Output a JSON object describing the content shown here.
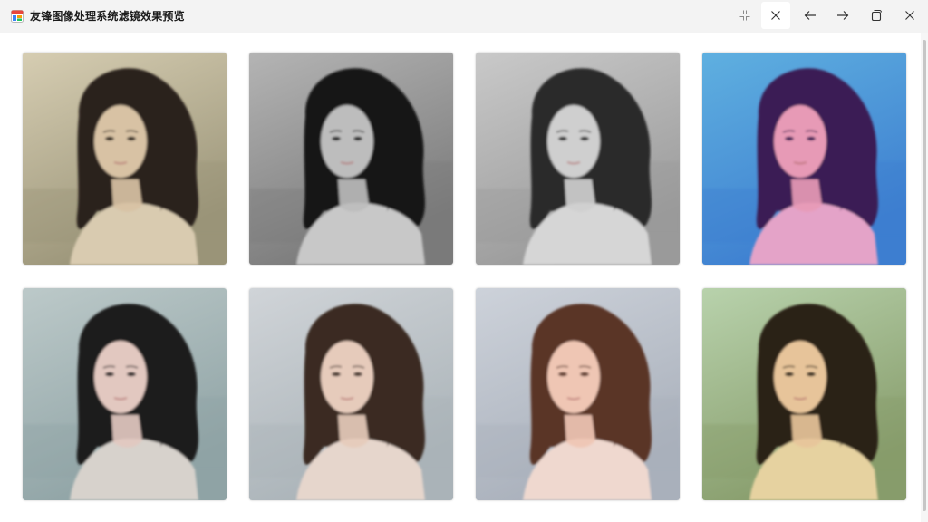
{
  "window": {
    "title": "友锋图像处理系统滤镜效果预览",
    "app_icon": "photo-app-icon",
    "buttons": [
      {
        "name": "compact-view-button",
        "icon": "compress-icon"
      },
      {
        "name": "close-preview-button",
        "icon": "close-icon"
      },
      {
        "name": "previous-button",
        "icon": "arrow-left-icon"
      },
      {
        "name": "next-button",
        "icon": "arrow-right-icon"
      },
      {
        "name": "restore-button",
        "icon": "restore-icon"
      },
      {
        "name": "close-window-button",
        "icon": "close-icon"
      }
    ]
  },
  "gallery": {
    "columns": 4,
    "rows": 2,
    "tiles": [
      {
        "name": "filter-preview-vintage",
        "bg1": "#d6cdb2",
        "bg2": "#9a9478",
        "hair": "#2a241c",
        "skin": "#d8c2a4",
        "sweater": "#d9cbb0"
      },
      {
        "name": "filter-preview-bw-high-contrast",
        "bg1": "#b4b4b4",
        "bg2": "#7a7a7a",
        "hair": "#161616",
        "skin": "#bdbdbd",
        "sweater": "#c8c8c8"
      },
      {
        "name": "filter-preview-grayscale",
        "bg1": "#c9c9c9",
        "bg2": "#9a9a9a",
        "hair": "#2b2b2b",
        "skin": "#cfcfcf",
        "sweater": "#d6d6d6"
      },
      {
        "name": "filter-preview-cool-blue",
        "bg1": "#5fb0e0",
        "bg2": "#3d7ed0",
        "hair": "#3a1f55",
        "skin": "#e79ab6",
        "sweater": "#e4a3c8"
      },
      {
        "name": "filter-preview-cool-tone",
        "bg1": "#bcc9c9",
        "bg2": "#8fa3a5",
        "hair": "#1c1c1e",
        "skin": "#e2c8c0",
        "sweater": "#d7d2cc"
      },
      {
        "name": "filter-preview-faded",
        "bg1": "#d0d4d8",
        "bg2": "#aab3b8",
        "hair": "#3a2a22",
        "skin": "#e6cbbb",
        "sweater": "#e6d6cc"
      },
      {
        "name": "filter-preview-warm-soft",
        "bg1": "#cdd2da",
        "bg2": "#a9b0bb",
        "hair": "#5a3426",
        "skin": "#efc6b4",
        "sweater": "#efd8cf"
      },
      {
        "name": "filter-preview-yellow-green",
        "bg1": "#b8d2ac",
        "bg2": "#879c6b",
        "hair": "#2a2014",
        "skin": "#e7c49a",
        "sweater": "#e6d2a0"
      }
    ]
  }
}
